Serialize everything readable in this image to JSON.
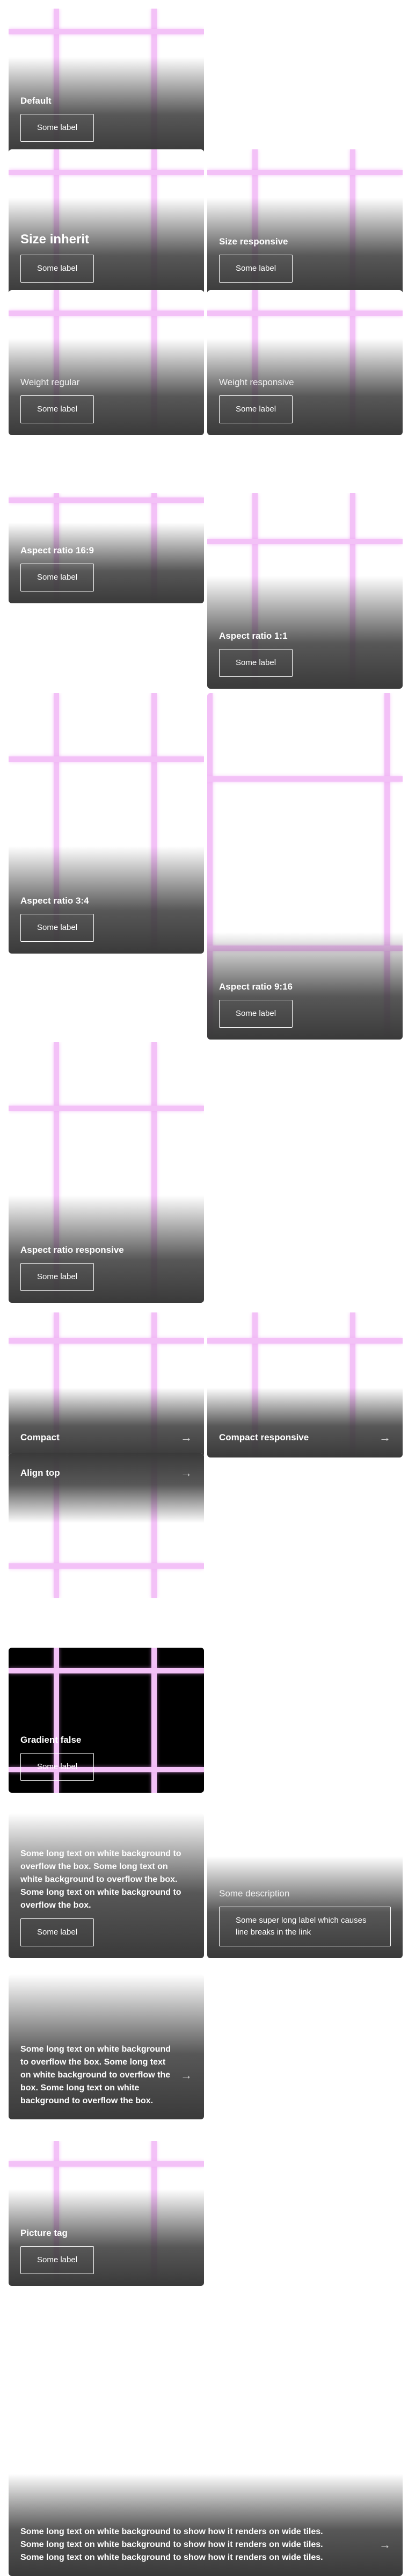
{
  "colors": {
    "placeholder_bar": "#f3c1f7",
    "overlay_dark": "#3a3a3a",
    "text": "#ffffff",
    "black_tile": "#000000"
  },
  "tiles": {
    "default": {
      "title": "Default",
      "button": "Some label"
    },
    "size_inherit": {
      "title": "Size inherit",
      "button": "Some label"
    },
    "size_responsive": {
      "title": "Size responsive",
      "button": "Some label"
    },
    "weight_regular": {
      "title": "Weight regular",
      "button": "Some label"
    },
    "weight_responsive": {
      "title": "Weight responsive",
      "button": "Some label"
    },
    "aspect_16_9": {
      "title": "Aspect ratio 16:9",
      "button": "Some label"
    },
    "aspect_1_1": {
      "title": "Aspect ratio 1:1",
      "button": "Some label"
    },
    "aspect_3_4": {
      "title": "Aspect ratio 3:4",
      "button": "Some label"
    },
    "aspect_9_16": {
      "title": "Aspect ratio 9:16",
      "button": "Some label"
    },
    "aspect_responsive": {
      "title": "Aspect ratio responsive",
      "button": "Some label"
    },
    "compact": {
      "title": "Compact",
      "icon": "arrow-right-icon"
    },
    "compact_responsive": {
      "title": "Compact responsive",
      "icon": "arrow-right-icon"
    },
    "align_top": {
      "title": "Align top",
      "icon": "arrow-right-icon"
    },
    "gradient_false": {
      "title": "Gradient false",
      "button": "Some label"
    },
    "long_text": {
      "title": "Some long text on white background to overflow the box. Some long text on white background to overflow the box. Some long text on white background to overflow the box.",
      "button": "Some label"
    },
    "some_description": {
      "title": "Some description",
      "button": "Some super long label which causes line breaks in the link"
    },
    "long_text_compact": {
      "title": "Some long text on white background to overflow the box. Some long text on white background to overflow the box. Some long text on white background to overflow the box.",
      "icon": "arrow-right-icon"
    },
    "picture_tag": {
      "title": "Picture tag",
      "button": "Some label"
    },
    "wide_tiles": {
      "title": "Some long text on white background to show how it renders on wide tiles. Some long text on white background to show how it renders on wide tiles. Some long text on white background to show how it renders on wide tiles.",
      "icon": "arrow-right-icon"
    }
  }
}
